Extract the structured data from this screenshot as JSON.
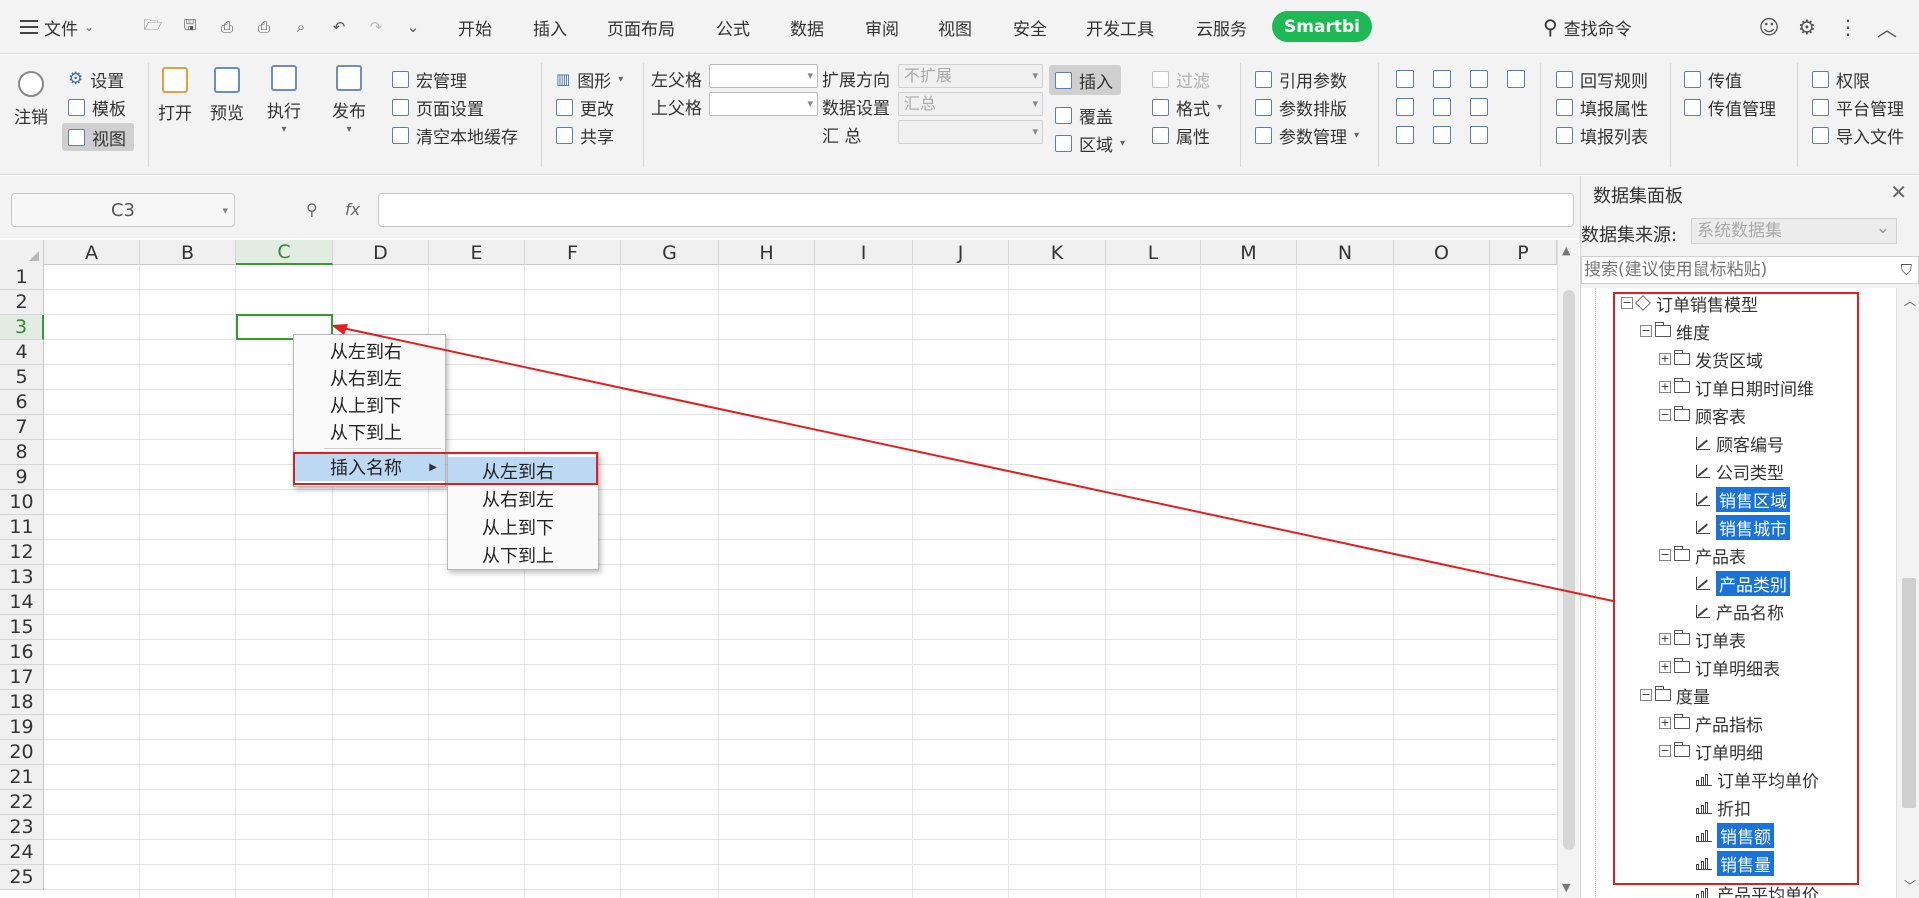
{
  "menubar": {
    "file_label": "文件",
    "tabs": [
      "开始",
      "插入",
      "页面布局",
      "公式",
      "数据",
      "审阅",
      "视图",
      "安全",
      "开发工具",
      "云服务"
    ],
    "smartbi_label": "Smartbi",
    "find_command": "查找命令"
  },
  "ribbon": {
    "logout": "注销",
    "settings": "设置",
    "template": "模板",
    "view": "视图",
    "open": "打开",
    "preview": "预览",
    "execute": "执行",
    "publish": "发布",
    "macro_manage": "宏管理",
    "page_setup": "页面设置",
    "clear_cache": "清空本地缓存",
    "chart": "图形",
    "change": "更改",
    "share": "共享",
    "left_parent": "左父格",
    "top_parent": "上父格",
    "expand_dir": "扩展方向",
    "expand_dir_value": "不扩展",
    "data_setting": "数据设置",
    "data_setting_value": "汇总",
    "summary": "汇  总",
    "insert": "插入",
    "cover": "覆盖",
    "region": "区域",
    "filter": "过滤",
    "format": "格式",
    "property": "属性",
    "ref_param": "引用参数",
    "param_layout": "参数排版",
    "param_manage": "参数管理",
    "writeback_rule": "回写规则",
    "fill_property": "填报属性",
    "fill_list": "填报列表",
    "pass_value": "传值",
    "pass_value_manage": "传值管理",
    "permission": "权限",
    "platform_manage": "平台管理",
    "import_file": "导入文件"
  },
  "formula": {
    "cell_ref": "C3",
    "fx": "fx"
  },
  "grid": {
    "columns": [
      "A",
      "B",
      "C",
      "D",
      "E",
      "F",
      "G",
      "H",
      "I",
      "J",
      "K",
      "L",
      "M",
      "N",
      "O",
      "P"
    ],
    "rows": [
      "1",
      "2",
      "3",
      "4",
      "5",
      "6",
      "7",
      "8",
      "9",
      "10",
      "11",
      "12",
      "13",
      "14",
      "15",
      "16",
      "17",
      "18",
      "19",
      "20",
      "21",
      "22",
      "23",
      "24",
      "25"
    ],
    "selected_column": "C",
    "selected_row": "3"
  },
  "context_menu": {
    "items": [
      "从左到右",
      "从右到左",
      "从上到下",
      "从下到上"
    ],
    "insert_name": "插入名称",
    "submenu": [
      "从左到右",
      "从右到左",
      "从上到下",
      "从下到上"
    ]
  },
  "panel": {
    "title": "数据集面板",
    "source_label": "数据集来源:",
    "source_value": "系统数据集",
    "search_placeholder": "搜索(建议使用鼠标粘贴)",
    "tree": {
      "root": "订单销售模型",
      "dimension": "维度",
      "ship_region": "发货区域",
      "order_date_dim": "订单日期时间维",
      "customer_table": "顾客表",
      "customer_no": "顾客编号",
      "company_type": "公司类型",
      "sales_region": "销售区域",
      "sales_city": "销售城市",
      "product_table": "产品表",
      "product_category": "产品类别",
      "product_name": "产品名称",
      "order_table": "订单表",
      "order_detail_table": "订单明细表",
      "measure": "度量",
      "product_metrics": "产品指标",
      "order_detail": "订单明细",
      "avg_unit_price": "订单平均单价",
      "discount": "折扣",
      "sales_amount": "销售额",
      "sales_volume": "销售量",
      "product_avg_price": "产品平均单价"
    }
  },
  "colors": {
    "accent_green": "#1db954",
    "selection_green": "#2e9e2e",
    "highlight_blue": "#1a73d9",
    "annotation_red": "#e02020"
  }
}
